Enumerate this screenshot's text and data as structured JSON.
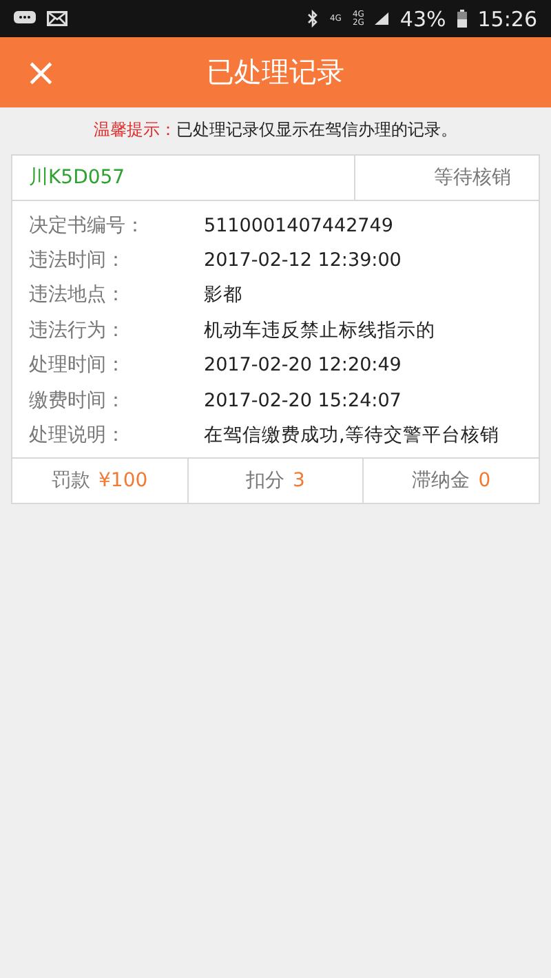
{
  "status_bar": {
    "network_labels": [
      "4G",
      "4G",
      "2G"
    ],
    "battery": "43%",
    "time": "15:26"
  },
  "header": {
    "close": "×",
    "title": "已处理记录"
  },
  "notice": {
    "label": "温馨提示：",
    "text": "已处理记录仅显示在驾信办理的记录。"
  },
  "record": {
    "plate": "川K5D057",
    "status": "等待核销",
    "fields": [
      {
        "label": "决定书编号：",
        "value": "5110001407442749"
      },
      {
        "label": "违法时间：",
        "value": "2017-02-12 12:39:00"
      },
      {
        "label": "违法地点：",
        "value": "影都"
      },
      {
        "label": "违法行为：",
        "value": "机动车违反禁止标线指示的"
      },
      {
        "label": "处理时间：",
        "value": "2017-02-20 12:20:49"
      },
      {
        "label": "缴费时间：",
        "value": "2017-02-20 15:24:07"
      },
      {
        "label": "处理说明：",
        "value": "在驾信缴费成功,等待交警平台核销"
      }
    ],
    "summary": [
      {
        "label": "罚款",
        "value": "¥100"
      },
      {
        "label": "扣分",
        "value": "3"
      },
      {
        "label": "滞纳金",
        "value": "0"
      }
    ]
  }
}
